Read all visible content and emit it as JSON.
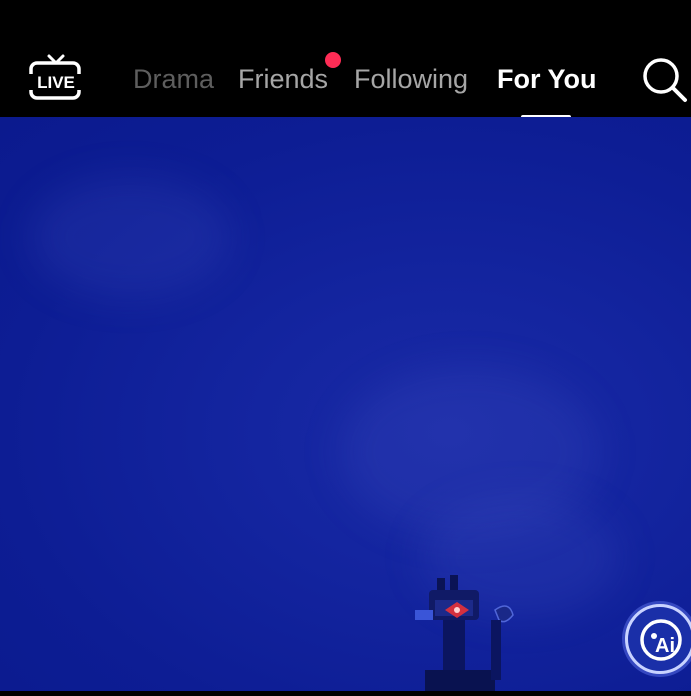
{
  "header": {
    "live_label": "LIVE",
    "tabs": [
      {
        "label": "Drama",
        "state": "inactive-dim"
      },
      {
        "label": "Friends",
        "state": "inactive",
        "has_notification_dot": true
      },
      {
        "label": "Following",
        "state": "inactive"
      },
      {
        "label": "For You",
        "state": "active"
      }
    ],
    "search_icon": "search-icon"
  },
  "video": {
    "background_color": "#0d1d94"
  },
  "ai_button": {
    "label": "Ai"
  },
  "colors": {
    "topbar_bg": "#000000",
    "active_tab": "#ffffff",
    "inactive_tab": "#a6a6a6",
    "dim_tab": "#5e5e5e",
    "notification_dot": "#fe2c55"
  }
}
